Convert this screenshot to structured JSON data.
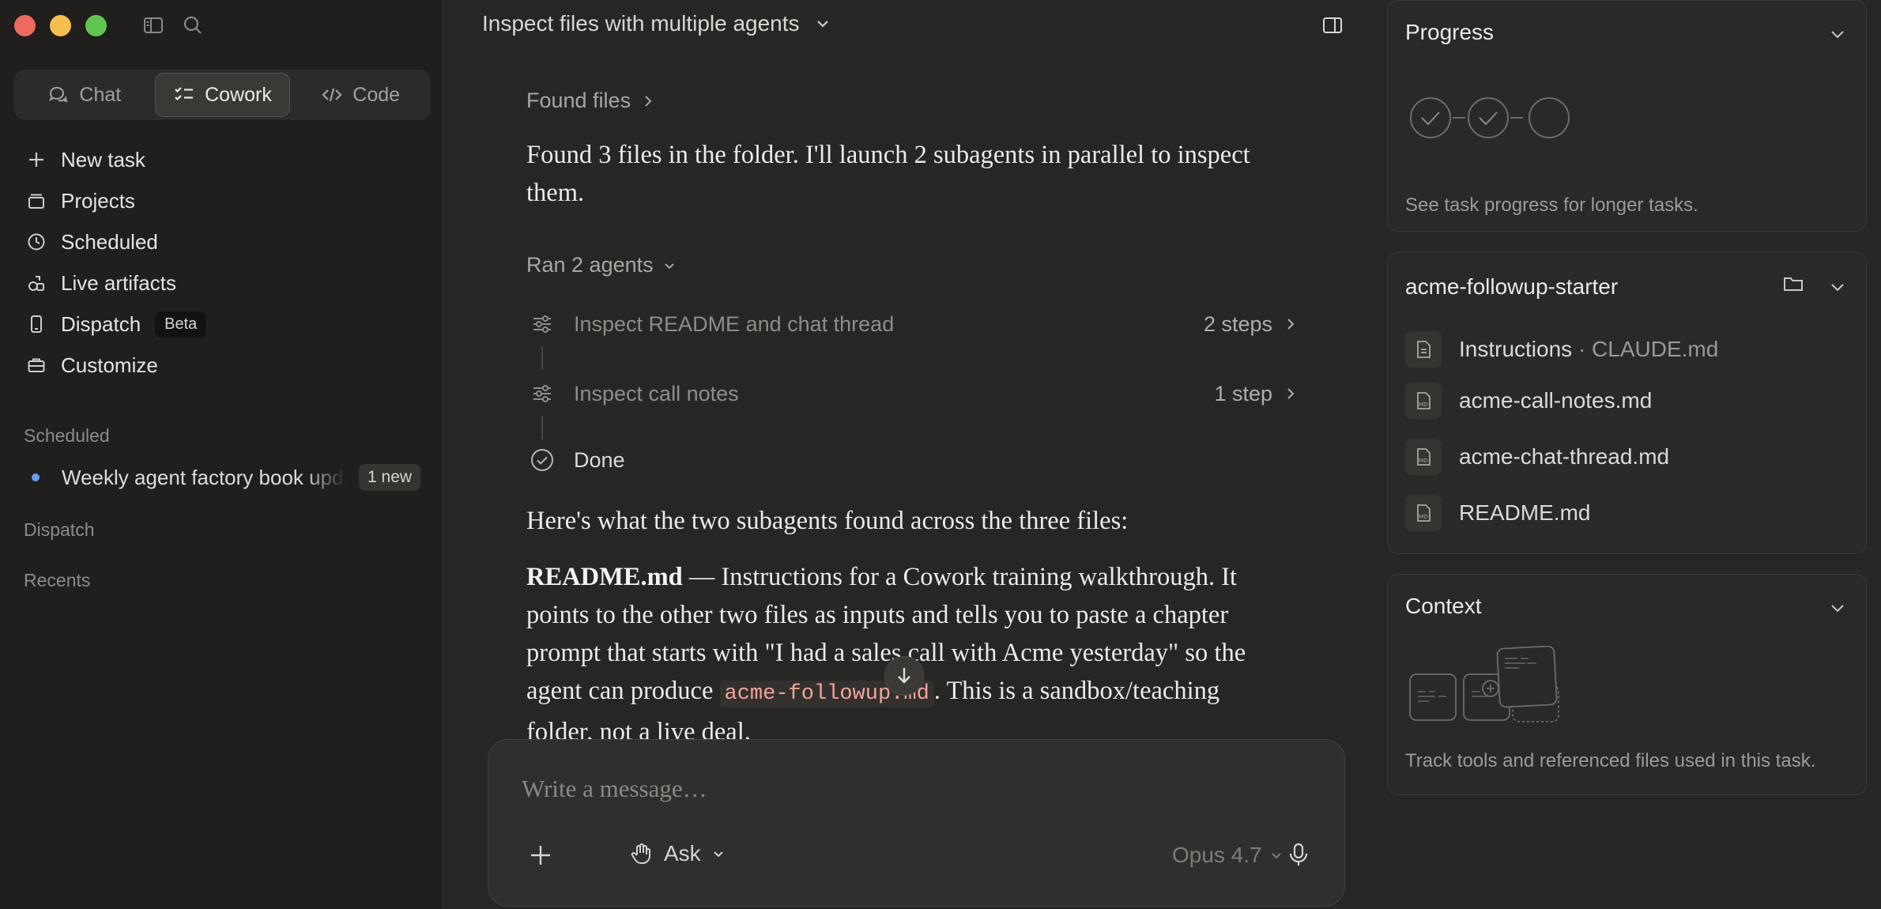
{
  "sidebar": {
    "mode_tabs": [
      {
        "label": "Chat",
        "icon": "chat-bubbles-icon"
      },
      {
        "label": "Cowork",
        "icon": "checklist-icon"
      },
      {
        "label": "Code",
        "icon": "code-icon"
      }
    ],
    "nav_items": [
      {
        "label": "New task",
        "icon": "plus-icon"
      },
      {
        "label": "Projects",
        "icon": "projects-icon"
      },
      {
        "label": "Scheduled",
        "icon": "clock-icon"
      },
      {
        "label": "Live artifacts",
        "icon": "artifacts-icon"
      },
      {
        "label": "Dispatch",
        "icon": "phone-icon",
        "badge": "Beta"
      },
      {
        "label": "Customize",
        "icon": "briefcase-icon"
      }
    ],
    "scheduled_section": "Scheduled",
    "scheduled_item": {
      "label": "Weekly agent factory book update",
      "badge": "1 new"
    },
    "dispatch_section": "Dispatch",
    "recents_section": "Recents"
  },
  "main": {
    "title": "Inspect files with multiple agents",
    "found_files": "Found files",
    "intro": "Found 3 files in the folder. I'll launch 2 subagents in parallel to inspect them.",
    "ran_agents": "Ran 2 agents",
    "agents": [
      {
        "label": "Inspect README and chat thread",
        "steps": "2 steps"
      },
      {
        "label": "Inspect call notes",
        "steps": "1 step"
      }
    ],
    "done": "Done",
    "summary_intro": "Here's what the two subagents found across the three files:",
    "readme_title": "README.md",
    "readme_text_1": " — Instructions for a Cowork training walkthrough. It points to the other two files as inputs and tells you to paste a chapter prompt that starts with \"I had a sales call with Acme yesterday\" so the agent can produce ",
    "readme_code": "acme-followup.md",
    "readme_text_2": ". This is a sandbox/teaching folder, not a live deal.",
    "composer": {
      "placeholder": "Write a message…",
      "mode": "Ask",
      "model": "Opus 4.7"
    }
  },
  "right_panel": {
    "progress": {
      "title": "Progress",
      "note": "See task progress for longer tasks."
    },
    "folder": {
      "title": "acme-followup-starter",
      "files": [
        {
          "name": "Instructions",
          "suffix": " · CLAUDE.md",
          "type": "doc"
        },
        {
          "name": "acme-call-notes.md",
          "type": "md"
        },
        {
          "name": "acme-chat-thread.md",
          "type": "md"
        },
        {
          "name": "README.md",
          "type": "md"
        }
      ]
    },
    "context": {
      "title": "Context",
      "note": "Track tools and referenced files used in this task."
    }
  },
  "colors": {
    "background": "#262624",
    "sidebar": "#201f1d",
    "accent_dot": "#6b9cf2",
    "code_text": "#f0a59c"
  }
}
